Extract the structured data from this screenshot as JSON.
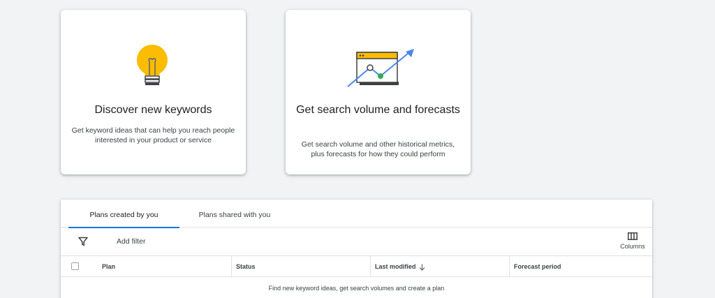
{
  "cards": [
    {
      "title": "Discover new keywords",
      "description": "Get keyword ideas that can help you reach people interested in your product or service",
      "icon": "lightbulb-icon"
    },
    {
      "title": "Get search volume and forecasts",
      "description": "Get search volume and other historical metrics, plus forecasts for how they could perform",
      "icon": "trend-chart-icon"
    }
  ],
  "tabs": [
    {
      "label": "Plans created by you",
      "active": true
    },
    {
      "label": "Plans shared with you",
      "active": false
    }
  ],
  "toolbar": {
    "filter_icon": "filter-icon",
    "add_filter_label": "Add filter",
    "columns_label": "Columns",
    "columns_icon": "columns-icon"
  },
  "table": {
    "columns": [
      "Plan",
      "Status",
      "Last modified",
      "Forecast period"
    ],
    "sort_icon": "arrow-down-icon",
    "empty_message": "Find new keyword ideas, get search volumes and create a plan"
  },
  "colors": {
    "accent": "#1a73e8",
    "bulb": "#fbbc04",
    "green": "#34a853",
    "background": "#f1f3f4"
  }
}
